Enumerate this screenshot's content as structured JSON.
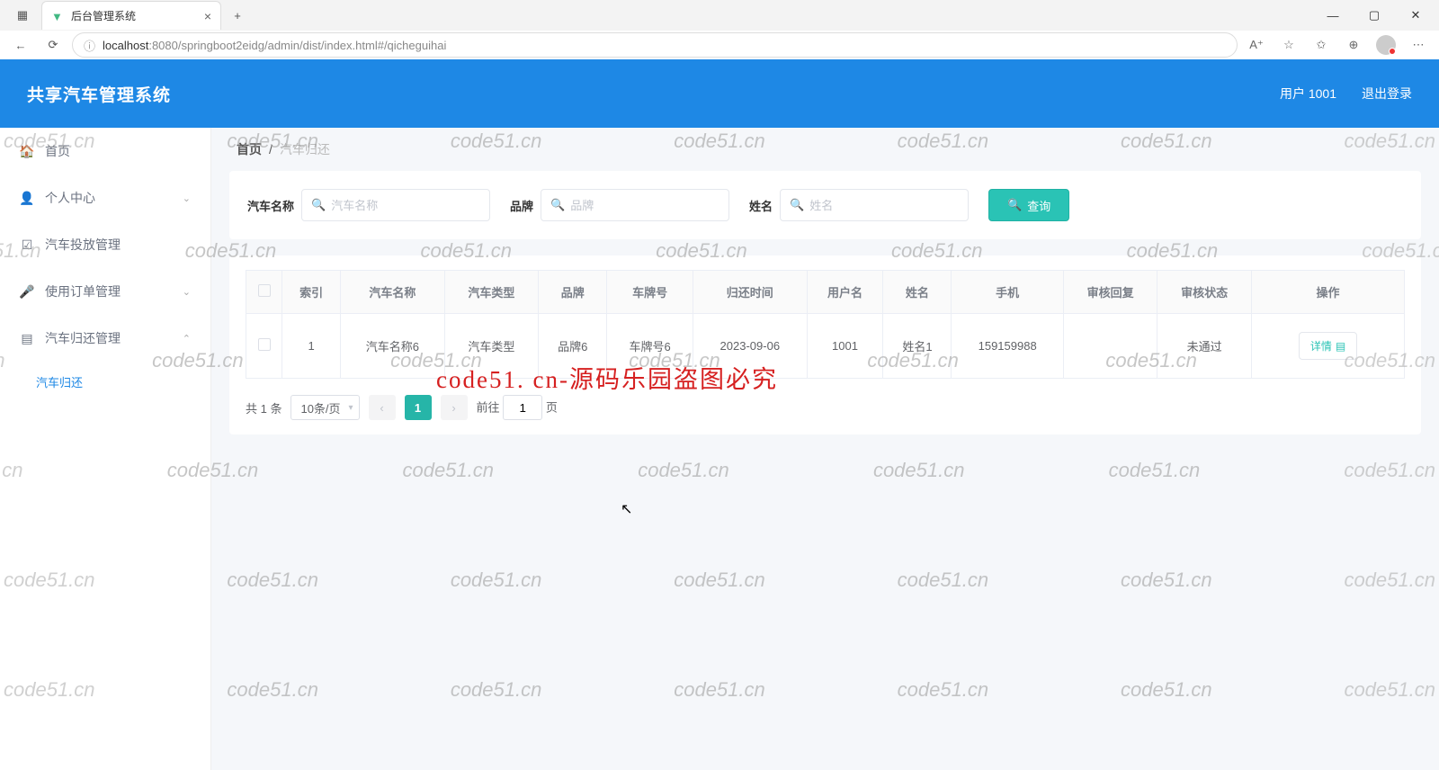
{
  "browser": {
    "tab_title": "后台管理系统",
    "url_host": "localhost",
    "url_path": ":8080/springboot2eidg/admin/dist/index.html#/qicheguihai"
  },
  "header": {
    "logo": "共享汽车管理系统",
    "user": "用户 1001",
    "logout": "退出登录"
  },
  "sidebar": {
    "items": [
      {
        "label": "首页"
      },
      {
        "label": "个人中心"
      },
      {
        "label": "汽车投放管理"
      },
      {
        "label": "使用订单管理"
      },
      {
        "label": "汽车归还管理"
      }
    ],
    "sub_label": "汽车归还"
  },
  "breadcrumb": {
    "home": "首页",
    "sep": "/",
    "current": "汽车归还"
  },
  "search": {
    "label_name": "汽车名称",
    "ph_name": "汽车名称",
    "label_brand": "品牌",
    "ph_brand": "品牌",
    "label_person": "姓名",
    "ph_person": "姓名",
    "query_btn": "查询"
  },
  "table": {
    "headers": [
      "",
      "索引",
      "汽车名称",
      "汽车类型",
      "品牌",
      "车牌号",
      "归还时间",
      "用户名",
      "姓名",
      "手机",
      "审核回复",
      "审核状态",
      "操作"
    ],
    "row": {
      "idx": "1",
      "car_name": "汽车名称6",
      "car_type": "汽车类型",
      "brand": "品牌6",
      "plate": "车牌号6",
      "return_time": "2023-09-06",
      "username": "1001",
      "name": "姓名1",
      "phone": "159159988",
      "reply": "",
      "status": "未通过",
      "action": "详情"
    }
  },
  "pagination": {
    "total": "共 1 条",
    "page_size": "10条/页",
    "current": "1",
    "goto_prefix": "前往",
    "goto_val": "1",
    "goto_suffix": "页"
  },
  "watermark": {
    "text": "code51.cn",
    "center": "code51. cn-源码乐园盗图必究"
  }
}
